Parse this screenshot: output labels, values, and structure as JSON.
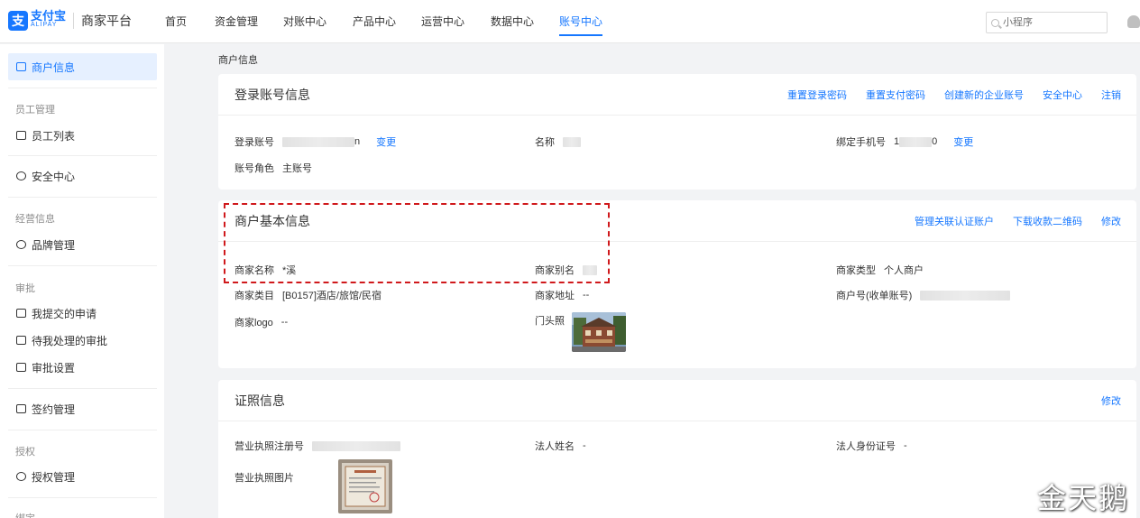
{
  "header": {
    "logo_cn": "支付宝",
    "logo_en": "ALIPAY",
    "platform": "商家平台",
    "nav": [
      "首页",
      "资金管理",
      "对账中心",
      "产品中心",
      "运营中心",
      "数据中心",
      "账号中心"
    ],
    "active_nav": "账号中心",
    "search_placeholder": "小程序"
  },
  "sidebar": {
    "active": "商户信息",
    "groups": {
      "staff": "员工管理",
      "business": "经营信息",
      "approval": "审批",
      "auth": "授权",
      "binding": "绑定"
    },
    "items": {
      "merchant_info": "商户信息",
      "staff_list": "员工列表",
      "security": "安全中心",
      "brand": "品牌管理",
      "my_requests": "我提交的申请",
      "pending": "待我处理的审批",
      "approval_settings": "审批设置",
      "contract": "签约管理",
      "auth_manage": "授权管理"
    }
  },
  "breadcrumb": "商户信息",
  "login_card": {
    "title": "登录账号信息",
    "actions": [
      "重置登录密码",
      "重置支付密码",
      "创建新的企业账号",
      "安全中心",
      "注销"
    ],
    "login_account_label": "登录账号",
    "login_account_suffix": "n",
    "change": "变更",
    "name_label": "名称",
    "phone_label": "绑定手机号",
    "phone_prefix": "1",
    "phone_suffix": "0",
    "role_label": "账号角色",
    "role_value": "主账号"
  },
  "merchant_card": {
    "title": "商户基本信息",
    "actions": [
      "管理关联认证账户",
      "下载收款二维码",
      "修改"
    ],
    "name_label": "商家名称",
    "name_value": "*溪",
    "alias_label": "商家别名",
    "type_label": "商家类型",
    "type_value": "个人商户",
    "category_label": "商家类目",
    "category_value": "[B0157]酒店/旅馆/民宿",
    "address_label": "商家地址",
    "address_value": "--",
    "merchant_no_label": "商户号(收单账号)",
    "logo_label": "商家logo",
    "logo_value": "--",
    "storefront_label": "门头照"
  },
  "license_card": {
    "title": "证照信息",
    "action": "修改",
    "reg_no_label": "营业执照注册号",
    "legal_name_label": "法人姓名",
    "legal_name_value": "-",
    "legal_id_label": "法人身份证号",
    "legal_id_value": "-",
    "license_img_label": "营业执照图片"
  },
  "watermark": "金天鹅"
}
